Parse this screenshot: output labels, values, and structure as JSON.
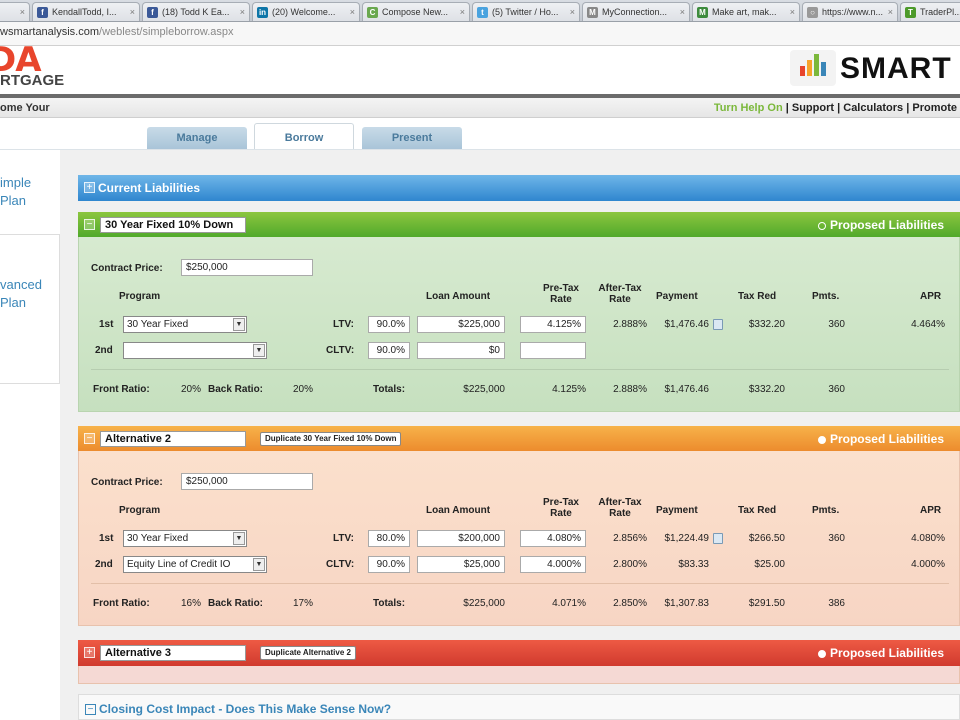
{
  "browser": {
    "tabs": [
      "KendallTodd, I...",
      "(18) Todd K Ea...",
      "(20) Welcome...",
      "Compose New...",
      "(5) Twitter / Ho...",
      "MyConnection...",
      "Make art, mak...",
      "https://www.n...",
      "TraderPl..."
    ],
    "url_host": "wsmartanalysis.com",
    "url_path": "/weblest/simpleborrow.aspx"
  },
  "header": {
    "logo_big": "DA",
    "logo_small": "RTGAGE",
    "smart_word": "SMART",
    "welcome": "ome Your",
    "help_link": "Turn Help On",
    "links": [
      "Support",
      "Calculators",
      "Promote"
    ],
    "sep": "|"
  },
  "tabs": [
    "Manage",
    "Borrow",
    "Present"
  ],
  "sidebar": {
    "simple": [
      "imple",
      "Plan"
    ],
    "advanced": [
      "vanced",
      "Plan"
    ]
  },
  "current_liabilities": {
    "title": "Current Liabilities",
    "toggle": "+"
  },
  "headers": {
    "contract_price": "Contract Price:",
    "program": "Program",
    "loan_amount": "Loan Amount",
    "pretax_rate": [
      "Pre-Tax",
      "Rate"
    ],
    "aftertax_rate": [
      "After-Tax",
      "Rate"
    ],
    "payment": "Payment",
    "tax_red": "Tax Red",
    "pmts": "Pmts.",
    "apr": "APR",
    "ltv": "LTV:",
    "cltv": "CLTV:",
    "first": "1st",
    "second": "2nd",
    "front_ratio": "Front Ratio:",
    "back_ratio": "Back Ratio:",
    "totals": "Totals:"
  },
  "panels": [
    {
      "toggle": "−",
      "name": "30 Year Fixed 10% Down",
      "proposed": "Proposed Liabilities",
      "contract_price": "$250,000",
      "row1": {
        "program": "30 Year Fixed",
        "ltv": "90.0%",
        "loan": "$225,000",
        "pretax": "4.125%",
        "aftertax": "2.888%",
        "payment": "$1,476.46",
        "taxred": "$332.20",
        "pmts": "360",
        "apr": "4.464%"
      },
      "row2": {
        "program": "",
        "cltv": "90.0%",
        "loan": "$0",
        "pretax": ""
      },
      "front": "20%",
      "back": "20%",
      "totals": {
        "loan": "$225,000",
        "pretax": "4.125%",
        "aftertax": "2.888%",
        "payment": "$1,476.46",
        "taxred": "$332.20",
        "pmts": "360"
      }
    },
    {
      "toggle": "−",
      "name": "Alternative 2",
      "duplicate": "Duplicate 30 Year Fixed 10% Down",
      "proposed": "Proposed Liabilities",
      "contract_price": "$250,000",
      "row1": {
        "program": "30 Year Fixed",
        "ltv": "80.0%",
        "loan": "$200,000",
        "pretax": "4.080%",
        "aftertax": "2.856%",
        "payment": "$1,224.49",
        "taxred": "$266.50",
        "pmts": "360",
        "apr": "4.080%"
      },
      "row2": {
        "program": "Equity Line of Credit IO",
        "cltv": "90.0%",
        "loan": "$25,000",
        "pretax": "4.000%",
        "aftertax": "2.800%",
        "payment": "$83.33",
        "taxred": "$25.00",
        "apr": "4.000%"
      },
      "front": "16%",
      "back": "17%",
      "totals": {
        "loan": "$225,000",
        "pretax": "4.071%",
        "aftertax": "2.850%",
        "payment": "$1,307.83",
        "taxred": "$291.50",
        "pmts": "386"
      }
    },
    {
      "toggle": "+",
      "name": "Alternative 3",
      "duplicate": "Duplicate Alternative 2",
      "proposed": "Proposed Liabilities"
    }
  ],
  "closing": {
    "toggle": "−",
    "title": "Closing Cost Impact - Does This Make Sense Now?"
  },
  "colors": {
    "blue_bar": "#2f86cf",
    "green_bar": "#4ea82a",
    "orange_bar": "#ec8a2c",
    "red_bar": "#d03a2e",
    "link": "#3a86b8"
  }
}
